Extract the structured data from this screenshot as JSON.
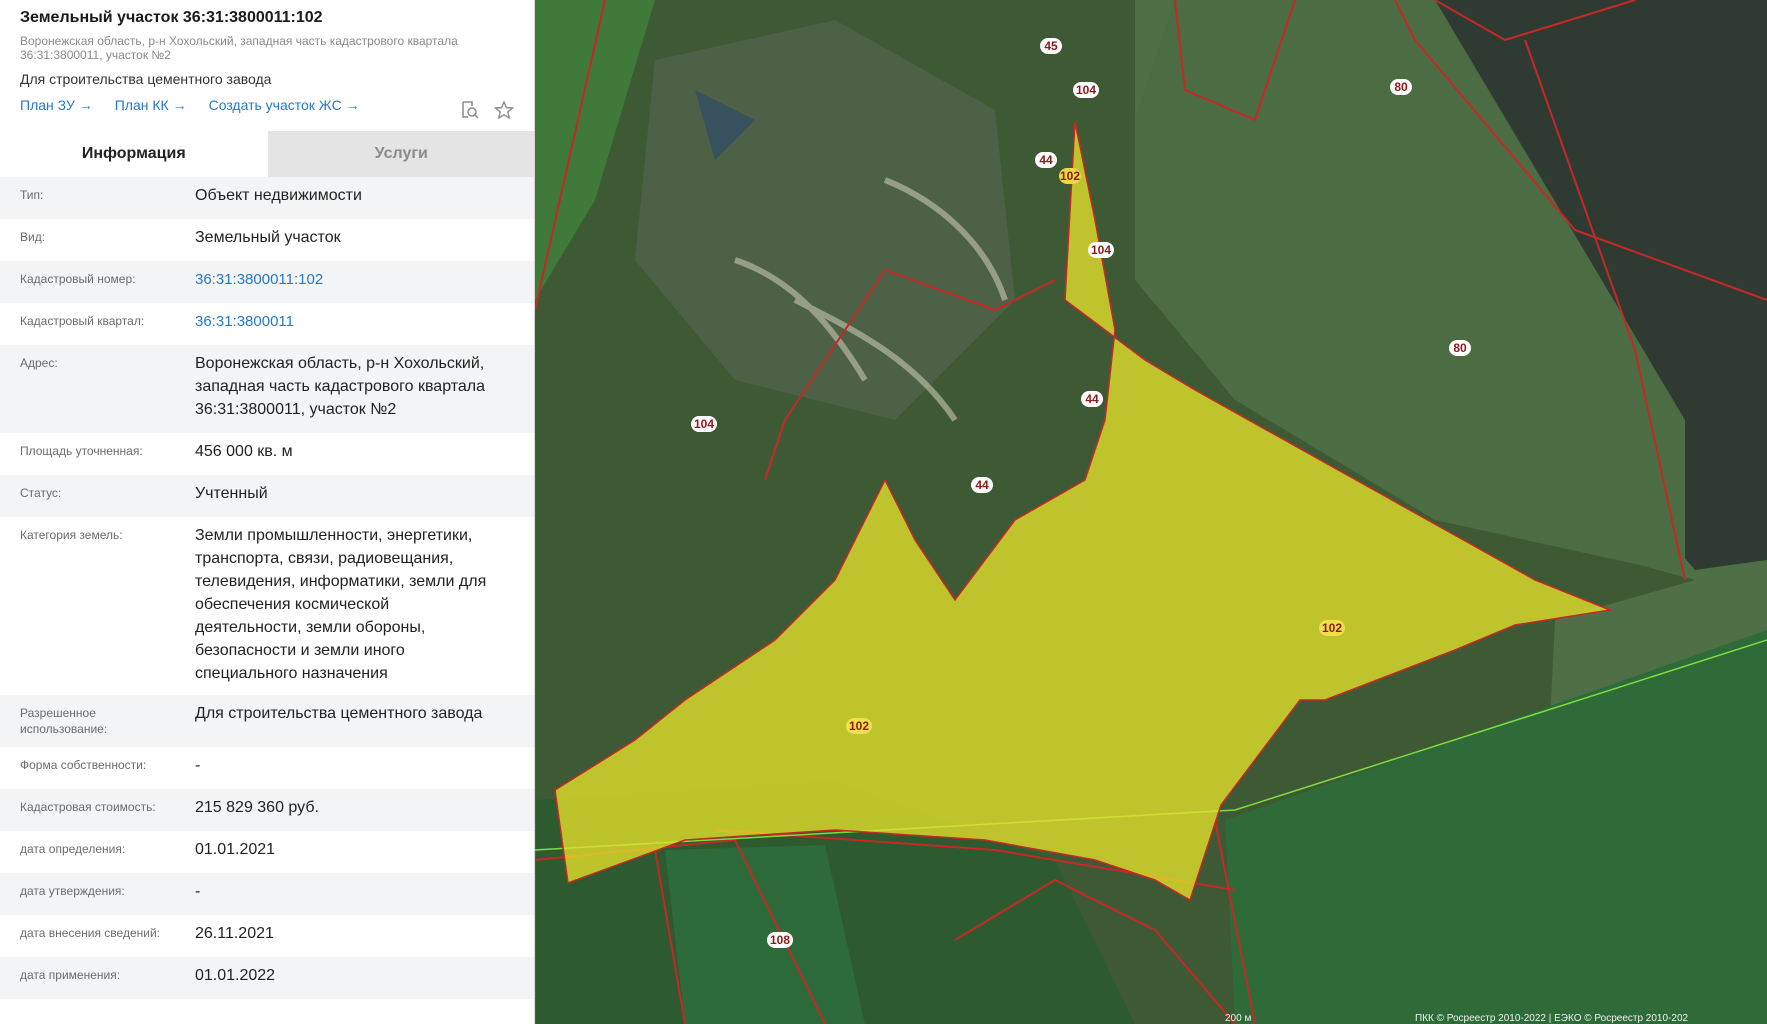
{
  "header": {
    "title": "Земельный участок 36:31:3800011:102",
    "subaddress_line1": "Воронежская область, р-н Хохольский, западная часть кадастрового квартала",
    "subaddress_line2": "36:31:3800011, участок №2",
    "purpose": "Для строительства цементного завода",
    "links": [
      "План ЗУ →",
      "План КК →",
      "Создать участок ЖС →"
    ]
  },
  "tabs": {
    "info": "Информация",
    "services": "Услуги"
  },
  "fields": {
    "type": {
      "label": "Тип:",
      "value": "Объект недвижимости"
    },
    "kind": {
      "label": "Вид:",
      "value": "Земельный участок"
    },
    "cad_number": {
      "label": "Кадастровый номер:",
      "value": "36:31:3800011:102"
    },
    "cad_quarter": {
      "label": "Кадастровый квартал:",
      "value": "36:31:3800011"
    },
    "address": {
      "label": "Адрес:",
      "l1": "Воронежская область, р-н Хохольский,",
      "l2": "западная часть кадастрового квартала",
      "l3": "36:31:3800011, участок №2"
    },
    "area": {
      "label": "Площадь уточненная:",
      "value": "456 000 кв. м"
    },
    "status": {
      "label": "Статус:",
      "value": "Учтенный"
    },
    "category": {
      "label": "Категория земель:",
      "l1": "Земли промышленности, энергетики,",
      "l2": "транспорта, связи, радиовещания,",
      "l3": "телевидения, информатики, земли для",
      "l4": "обеспечения космической",
      "l5": "деятельности, земли обороны,",
      "l6": "безопасности и земли иного",
      "l7": "специального назначения"
    },
    "permitted": {
      "label1": "Разрешенное",
      "label2": "использование:",
      "value": "Для строительства цементного завода"
    },
    "ownership": {
      "label": "Форма собственности:",
      "value": "-"
    },
    "cad_cost": {
      "label": "Кадастровая стоимость:",
      "value": "215 829 360 руб."
    },
    "date_determined": {
      "label": "дата определения:",
      "value": "01.01.2021"
    },
    "date_approved": {
      "label": "дата утверждения:",
      "value": "-"
    },
    "date_entered": {
      "label": "дата внесения сведений:",
      "value": "26.11.2021"
    },
    "date_applied": {
      "label": "дата применения:",
      "value": "01.01.2022"
    }
  },
  "map": {
    "parcel_labels": [
      "45",
      "104",
      "80",
      "44",
      "102",
      "104",
      "80",
      "104",
      "44",
      "44",
      "102",
      "102",
      "108"
    ],
    "scale": "200 м",
    "credits": "ПКК © Росреестр 2010-2022 | ЕЭКО © Росреестр 2010-202",
    "colors": {
      "selected_fill": "#e6e22a",
      "boundary": "#c62828",
      "label_bg": "#ffffff",
      "label_text": "#8b1a1a"
    }
  }
}
